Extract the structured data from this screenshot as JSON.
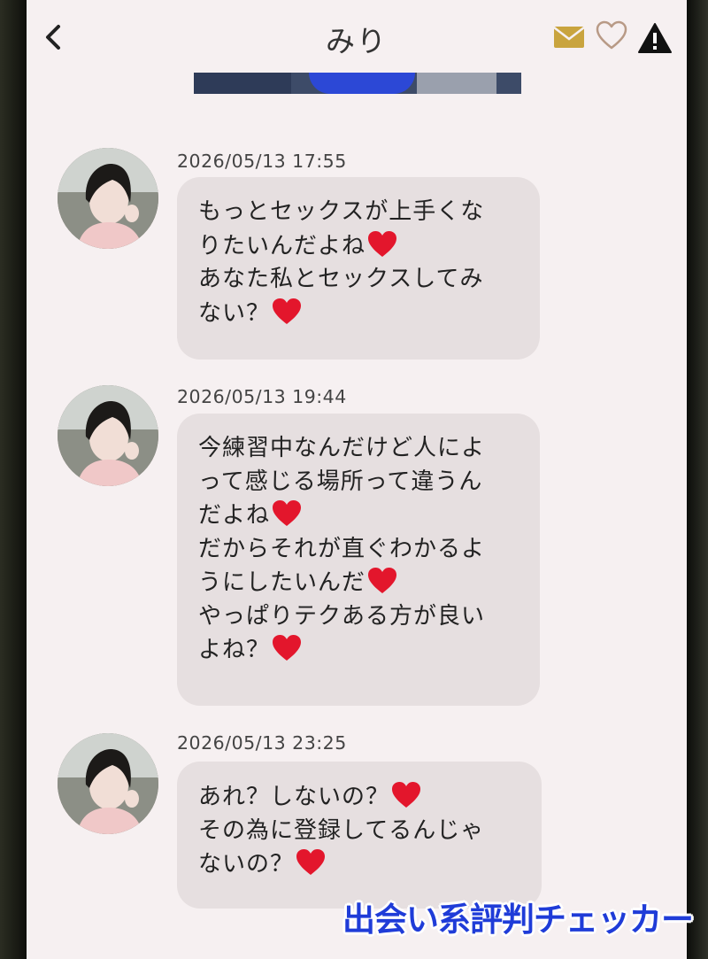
{
  "header": {
    "title": "みり",
    "back_icon": "chevron-left-icon",
    "mail_icon": "mail-icon",
    "favorite_icon": "heart-outline-icon",
    "report_icon": "warning-icon"
  },
  "colors": {
    "screen_bg": "#f6f0f1",
    "bubble_bg": "#e6dfe0",
    "mail_gold": "#c9a43e",
    "heart_outline": "#b89a86",
    "watermark_blue": "#1f3cd8",
    "emoji_red": "#e3162c"
  },
  "messages": [
    {
      "timestamp": "2026/05/13 17:55",
      "lines": [
        "もっとセックスが上手くな",
        "りたいんだよね",
        "あなた私とセックスしてみ",
        "ない？"
      ]
    },
    {
      "timestamp": "2026/05/13 19:44",
      "lines": [
        "今練習中なんだけど人によ",
        "って感じる場所って違うん",
        "だよね",
        "だからそれが直ぐわかるよ",
        "うにしたいんだ",
        "やっぱりテクある方が良い",
        "よね？"
      ]
    },
    {
      "timestamp": "2026/05/13 23:25",
      "lines": [
        "あれ？しないの？",
        "その為に登録してるんじゃ",
        "ないの？"
      ]
    }
  ],
  "watermark": "出会い系評判チェッカー"
}
